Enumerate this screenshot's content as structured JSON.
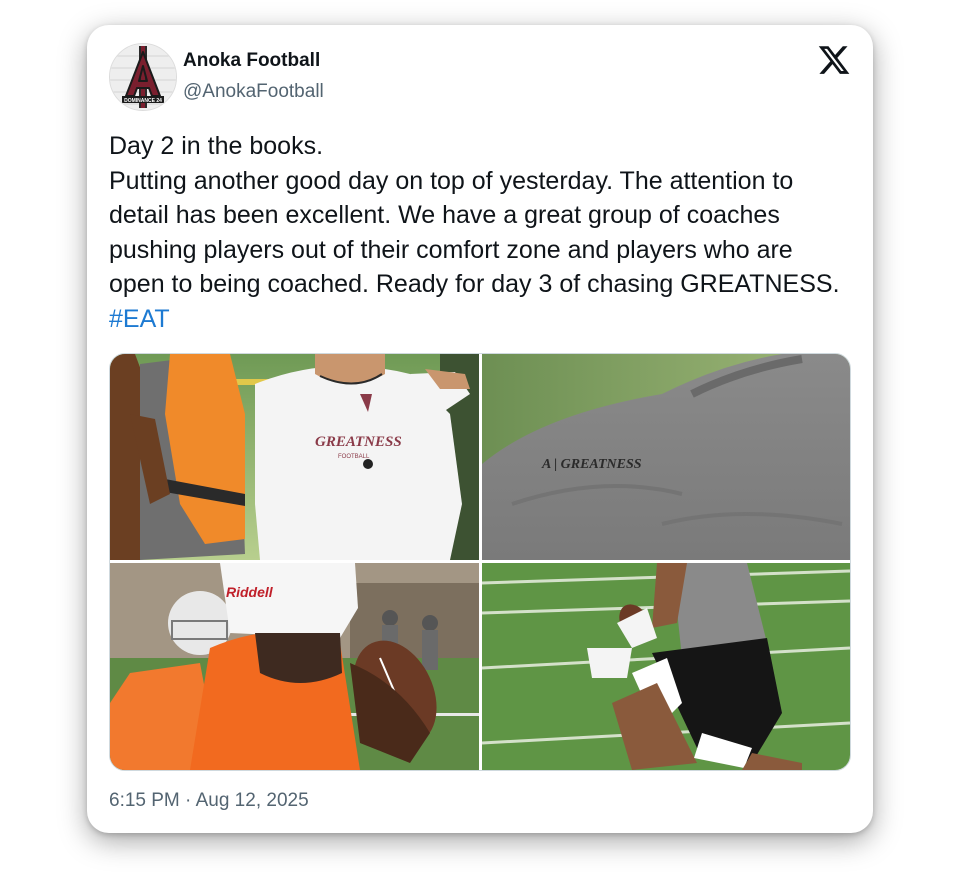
{
  "tweet": {
    "display_name": "Anoka Football",
    "handle": "@AnokaFootball",
    "text_lines": [
      "Day 2 in the books.",
      "Putting another good day on top of yesterday. The attention to detail has been excellent. We have a great group of coaches pushing players out of their comfort zone and players who are open to being coached.  Ready for day 3 of chasing GREATNESS."
    ],
    "hashtag": "#EAT",
    "timestamp": "6:15 PM · Aug 12, 2025"
  },
  "avatar": {
    "letter": "A",
    "logo_text": "DOMINANCE 24"
  },
  "platform_icon": "x-logo-icon",
  "photos": [
    {
      "description_icon": "photo",
      "shirt_text": "GREATNESS",
      "shirt_subtext": "FOOTBALL"
    },
    {
      "description_icon": "photo",
      "shirt_text": "A | GREATNESS"
    },
    {
      "description_icon": "photo",
      "helmet_text": "Riddell"
    },
    {
      "description_icon": "photo"
    }
  ],
  "colors": {
    "text": "#0f1419",
    "secondary": "#536471",
    "link": "#1d7ad2",
    "brand_maroon": "#7a1f2e"
  }
}
